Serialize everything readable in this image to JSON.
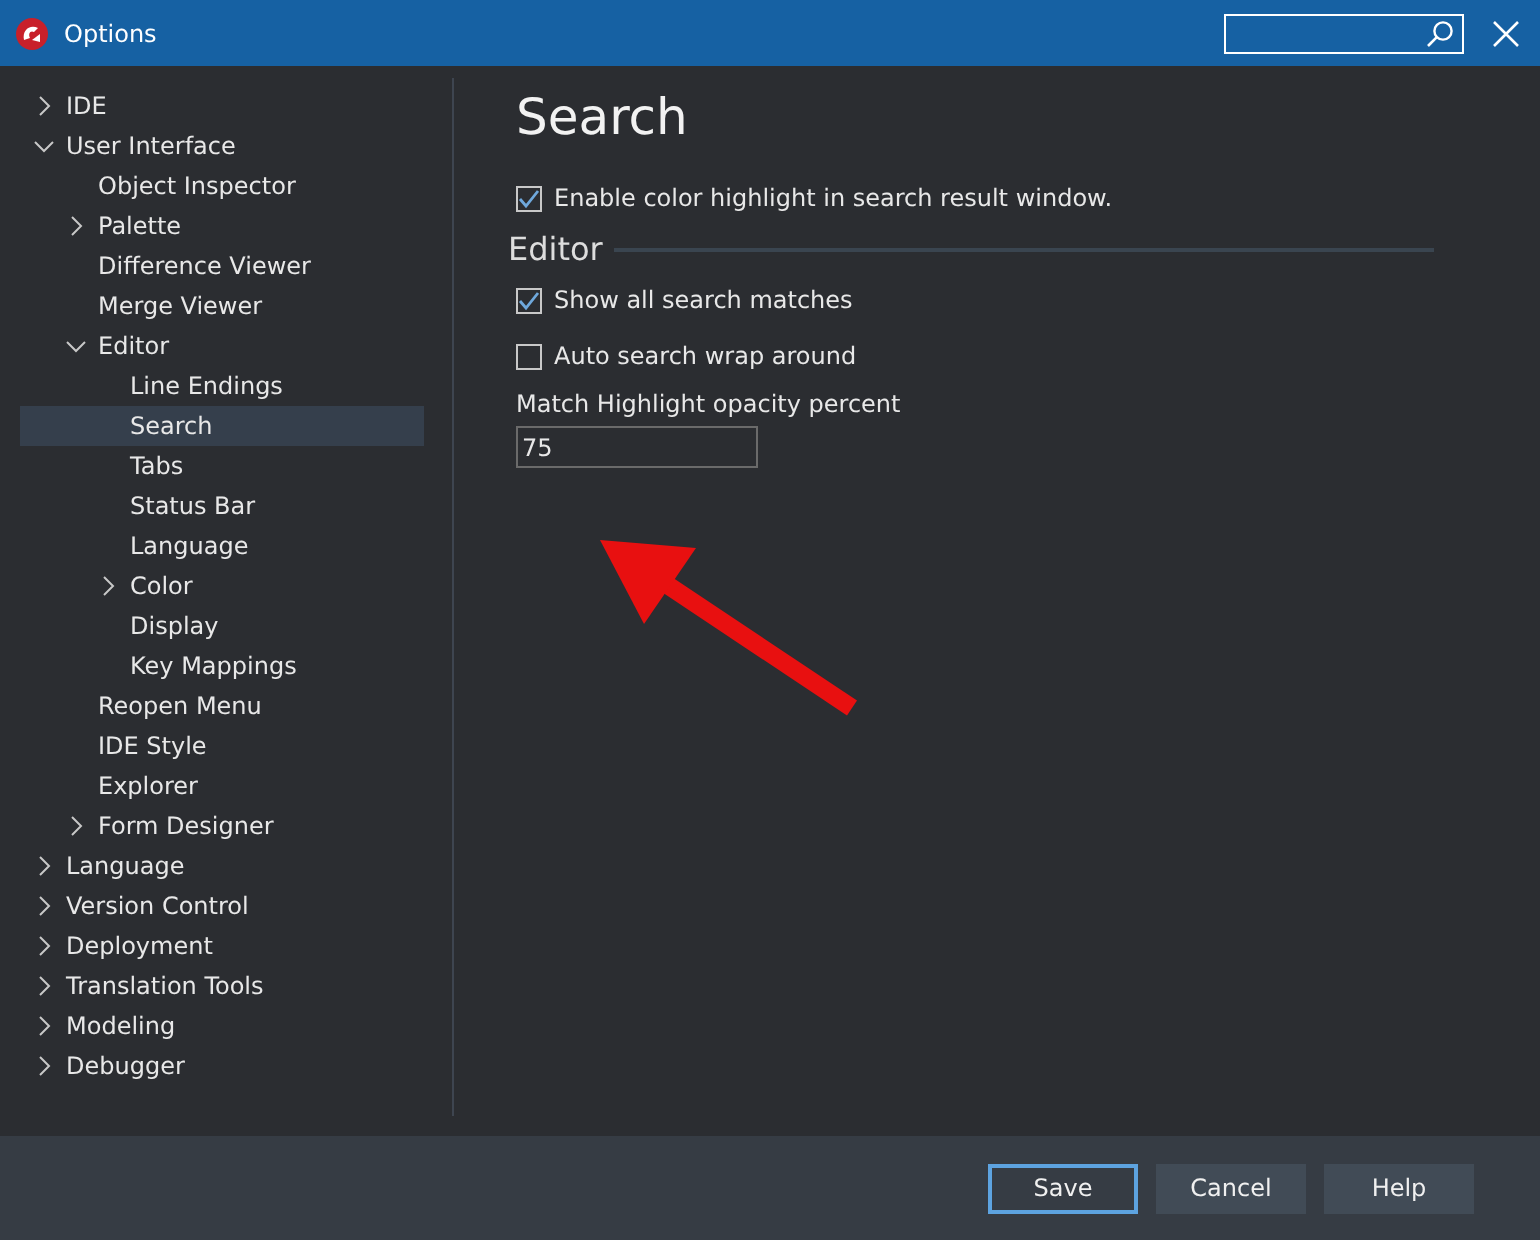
{
  "window": {
    "title": "Options"
  },
  "tree": [
    {
      "label": "IDE",
      "kind": "group",
      "expanded": false,
      "selected": false
    },
    {
      "label": "User Interface",
      "kind": "group",
      "expanded": true,
      "selected": false,
      "children": [
        {
          "label": "Object Inspector",
          "kind": "leaf",
          "selected": false
        },
        {
          "label": "Palette",
          "kind": "group",
          "expanded": false,
          "selected": false
        },
        {
          "label": "Difference Viewer",
          "kind": "leaf",
          "selected": false
        },
        {
          "label": "Merge Viewer",
          "kind": "leaf",
          "selected": false
        },
        {
          "label": "Editor",
          "kind": "group",
          "expanded": true,
          "selected": false,
          "children": [
            {
              "label": "Line Endings",
              "kind": "leaf",
              "selected": false
            },
            {
              "label": "Search",
              "kind": "leaf",
              "selected": true
            },
            {
              "label": "Tabs",
              "kind": "leaf",
              "selected": false
            },
            {
              "label": "Status Bar",
              "kind": "leaf",
              "selected": false
            },
            {
              "label": "Language",
              "kind": "leaf",
              "selected": false
            },
            {
              "label": "Color",
              "kind": "group",
              "expanded": false,
              "selected": false
            },
            {
              "label": "Display",
              "kind": "leaf",
              "selected": false
            },
            {
              "label": "Key Mappings",
              "kind": "leaf",
              "selected": false
            }
          ]
        },
        {
          "label": "Reopen Menu",
          "kind": "leaf",
          "selected": false
        },
        {
          "label": "IDE Style",
          "kind": "leaf",
          "selected": false
        },
        {
          "label": "Explorer",
          "kind": "leaf",
          "selected": false
        },
        {
          "label": "Form Designer",
          "kind": "group",
          "expanded": false,
          "selected": false
        }
      ]
    },
    {
      "label": "Language",
      "kind": "group",
      "expanded": false,
      "selected": false
    },
    {
      "label": "Version Control",
      "kind": "group",
      "expanded": false,
      "selected": false
    },
    {
      "label": "Deployment",
      "kind": "group",
      "expanded": false,
      "selected": false
    },
    {
      "label": "Translation Tools",
      "kind": "group",
      "expanded": false,
      "selected": false
    },
    {
      "label": "Modeling",
      "kind": "group",
      "expanded": false,
      "selected": false
    },
    {
      "label": "Debugger",
      "kind": "group",
      "expanded": false,
      "selected": false
    }
  ],
  "page": {
    "title": "Search",
    "options": [
      {
        "label": "Enable color highlight in search result window.",
        "checked": true
      }
    ],
    "section": {
      "title": "Editor",
      "options": [
        {
          "label": "Show all search matches",
          "checked": true
        },
        {
          "label": "Auto search wrap around",
          "checked": false
        }
      ],
      "field": {
        "label": "Match Highlight opacity percent",
        "value": "75"
      }
    }
  },
  "buttons": [
    {
      "label": "Save",
      "default": true
    },
    {
      "label": "Cancel",
      "default": false
    },
    {
      "label": "Help",
      "default": false
    }
  ]
}
